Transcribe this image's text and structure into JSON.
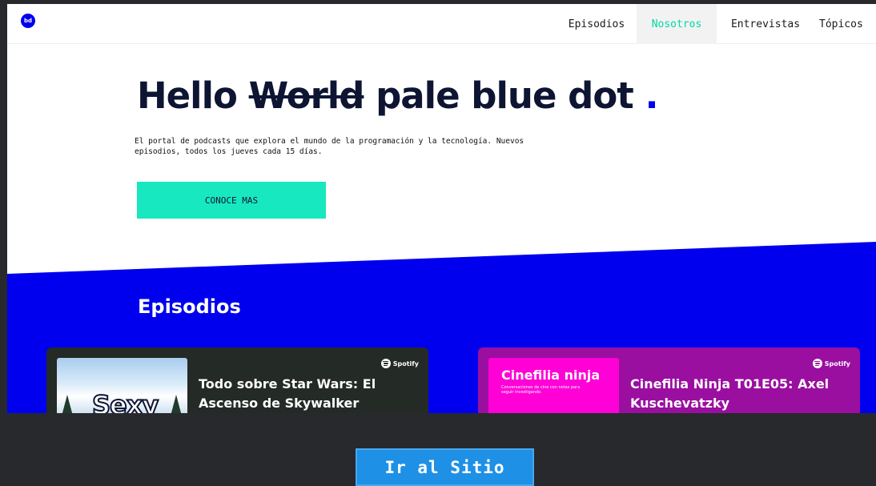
{
  "nav": {
    "logo_text": "bd",
    "links": [
      "Episodios",
      "Nosotros",
      "Entrevistas",
      "Tópicos"
    ],
    "active_link": "Nosotros"
  },
  "hero": {
    "title_part1": "Hello",
    "title_strike": "World",
    "title_part2": "pale blue dot",
    "title_dot": ".",
    "description": "El portal de podcasts que explora el mundo de la programación y la tecnología. Nuevos episodios, todos los jueves cada 15 días.",
    "cta_label": "CONOCE MAS"
  },
  "episodes": {
    "section_title": "Episodios",
    "cards": [
      {
        "title": "Todo sobre Star Wars: El Ascenso de Skywalker",
        "platform": "Spotify",
        "thumb_text": "Sexy"
      },
      {
        "title": "Cinefilia Ninja T01E05: Axel Kuschevatzky",
        "platform": "Spotify",
        "thumb_title": "Cinefilia ninja",
        "thumb_subtitle": "Conversaciones de cine con notas para seguir investigando."
      }
    ]
  },
  "footer_button": {
    "label": "Ir al Sitio"
  },
  "colors": {
    "accent_blue": "#0000ee",
    "accent_mint": "#17e8bf",
    "dark_bg": "#27292c",
    "button_blue": "#1e90e6"
  }
}
